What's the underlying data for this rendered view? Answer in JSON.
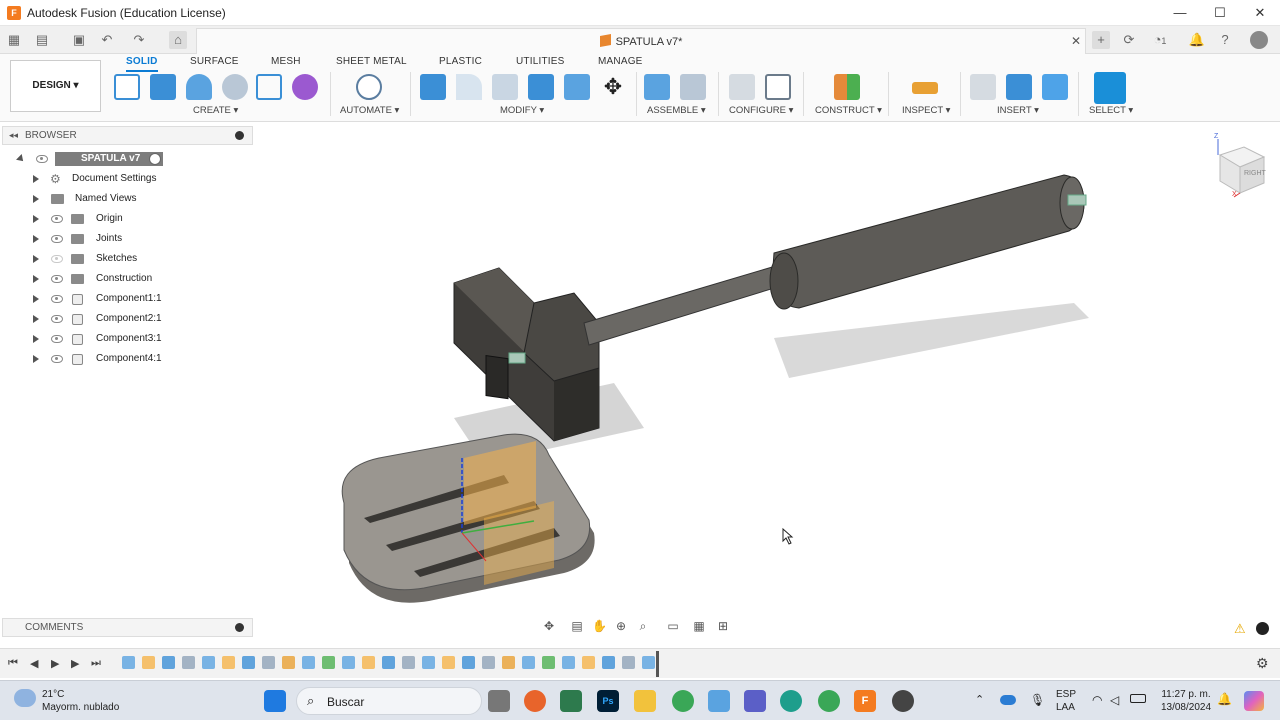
{
  "window": {
    "title": "Autodesk Fusion (Education License)",
    "minimize": "—",
    "maximize": "☐",
    "close": "✕"
  },
  "document": {
    "tab_title": "SPATULA v7*",
    "close": "✕",
    "notif_count": "1"
  },
  "ribbon": {
    "workspace": "DESIGN ▾",
    "tabs": [
      "SOLID",
      "SURFACE",
      "MESH",
      "SHEET METAL",
      "PLASTIC",
      "UTILITIES",
      "MANAGE"
    ],
    "active_tab": "SOLID",
    "groups": [
      "CREATE ▾",
      "AUTOMATE ▾",
      "MODIFY ▾",
      "ASSEMBLE ▾",
      "CONFIGURE ▾",
      "CONSTRUCT ▾",
      "INSPECT ▾",
      "INSERT ▾",
      "SELECT ▾"
    ]
  },
  "browser": {
    "header": "BROWSER",
    "root": "SPATULA v7",
    "items": [
      "Document Settings",
      "Named Views",
      "Origin",
      "Joints",
      "Sketches",
      "Construction",
      "Component1:1",
      "Component2:1",
      "Component3:1",
      "Component4:1"
    ]
  },
  "comments": {
    "header": "COMMENTS"
  },
  "viewcube": {
    "face": "RIGHT",
    "z": "Z",
    "x": "X"
  },
  "taskbar": {
    "weather_temp": "21°C",
    "weather_desc": "Mayorm. nublado",
    "search_placeholder": "Buscar",
    "lang_1": "ESP",
    "lang_2": "LAA",
    "time": "11:27 p. m.",
    "date": "13/08/2024"
  },
  "colors": {
    "accent": "#0a7bd4",
    "fusion_orange": "#f47b20",
    "model_dark": "#4a4a47",
    "sketch_orange": "#f5b34a"
  }
}
